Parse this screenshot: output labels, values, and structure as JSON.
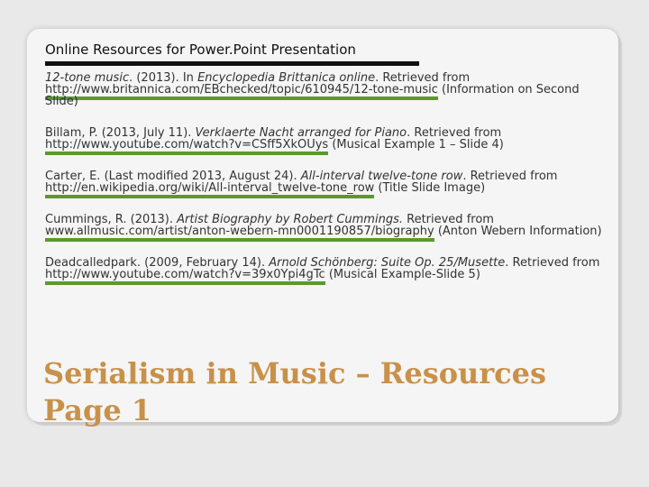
{
  "header": {
    "title": "Online Resources for Power.Point Presentation"
  },
  "references": [
    {
      "author": "12-tone music",
      "date": ". (2013). In ",
      "title": "Encyclopedia Brittanica online",
      "retrieved": ". Retrieved from ",
      "url": "http://www.britannica.com/EBchecked/topic/610945/12-tone-music",
      "note": " (Information on Second Slide)"
    },
    {
      "author": "Billam, P. (2013, July 11). ",
      "title": "Verklaerte Nacht arranged for Piano",
      "retrieved": ". Retrieved from ",
      "url": "http://www.youtube.com/watch?v=CSff5XkOUys",
      "note": " (Musical Example 1 – Slide 4)"
    },
    {
      "author": "Carter, E. (Last modified 2013, August 24). ",
      "title": "All-interval twelve-tone row",
      "retrieved": ". Retrieved from ",
      "url": "http://en.wikipedia.org/wiki/All-interval_twelve-tone_row",
      "note": " (Title Slide Image)"
    },
    {
      "author": "Cummings, R. (2013). ",
      "title": "Artist Biography by Robert Cummings.",
      "retrieved": " Retrieved from ",
      "url": "www.allmusic.com/artist/anton-webern-mn0001190857/biography",
      "note": " (Anton Webern Information)"
    },
    {
      "author": "Deadcalledpark. (2009, February 14). ",
      "title": "Arnold Schönberg: Suite Op. 25/Musette",
      "retrieved": ". Retrieved from ",
      "url": "http://www.youtube.com/watch?v=39x0Ypi4gTc",
      "note": " (Musical Example-Slide 5)"
    }
  ],
  "slide_title": {
    "line1": "Serialism in Music – Resources",
    "line2": "Page 1"
  }
}
